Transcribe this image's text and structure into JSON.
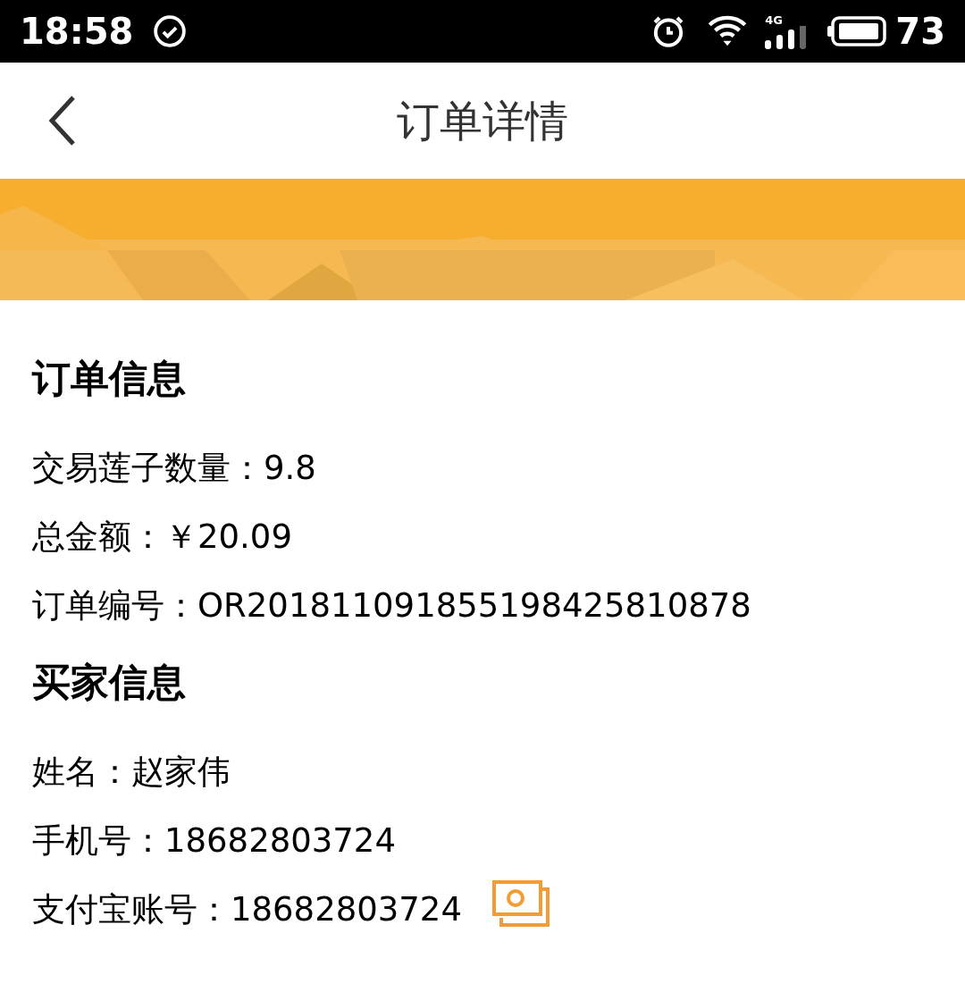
{
  "status_bar": {
    "time": "18:58",
    "network": "4G",
    "battery": "73"
  },
  "header": {
    "title": "订单详情"
  },
  "sections": [
    {
      "title": "订单信息",
      "rows": [
        {
          "label": "交易莲子数量：",
          "value": "9.8"
        },
        {
          "label": "总金额：",
          "value": "￥20.09"
        },
        {
          "label": "订单编号：",
          "value": "OR201811091855198425810878"
        }
      ]
    },
    {
      "title": "买家信息",
      "rows": [
        {
          "label": "姓名：",
          "value": "赵家伟"
        },
        {
          "label": "手机号：",
          "value": "18682803724"
        },
        {
          "label": "支付宝账号：",
          "value": "18682803724",
          "kind": "money"
        }
      ]
    }
  ]
}
